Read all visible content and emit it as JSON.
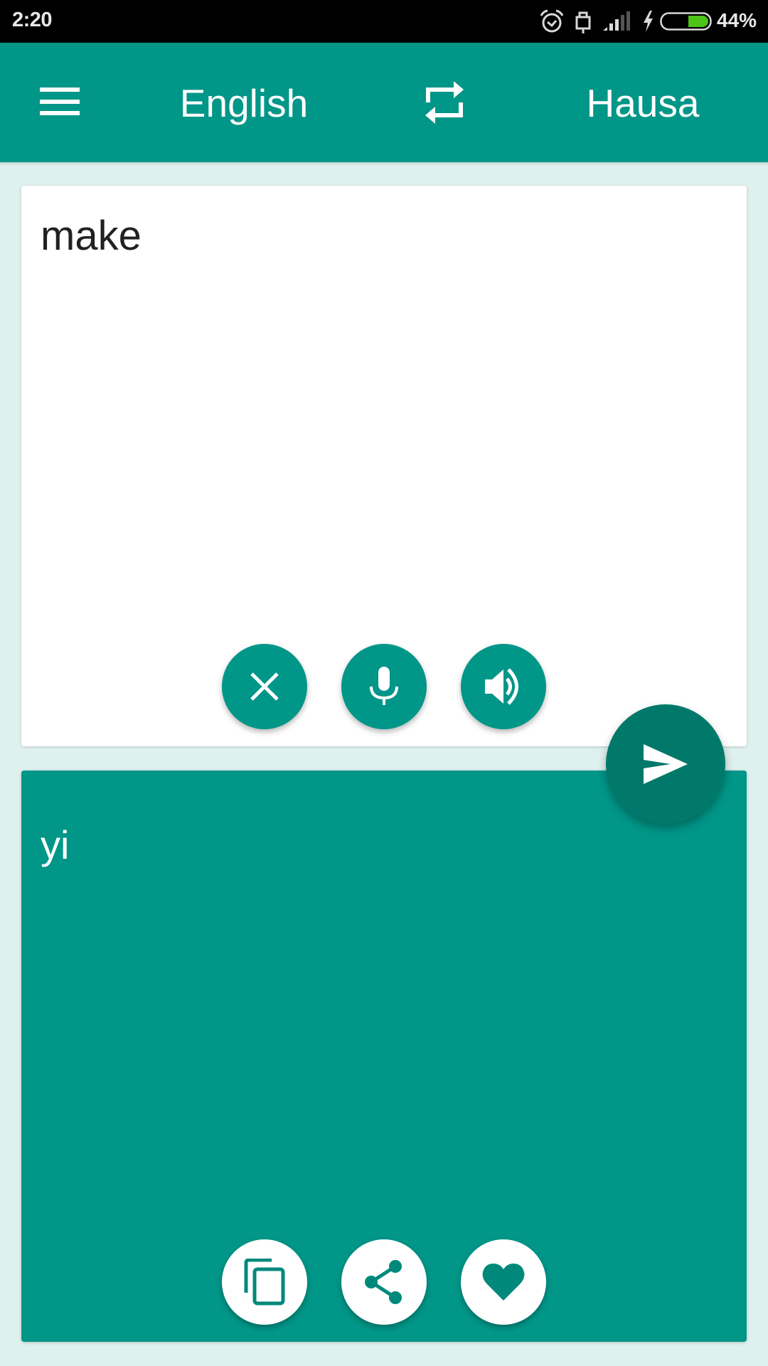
{
  "status_bar": {
    "time": "2:20",
    "battery_percent": "44%",
    "battery_level": 0.44,
    "icons": [
      "alarm-icon",
      "usb-icon",
      "signal-icon",
      "charging-icon",
      "battery-icon"
    ]
  },
  "app_bar": {
    "menu_icon": "menu-icon",
    "source_language": "English",
    "swap_icon": "swap-icon",
    "target_language": "Hausa"
  },
  "input_card": {
    "text": "make",
    "buttons": [
      {
        "name": "clear",
        "icon": "close-icon"
      },
      {
        "name": "voice-input",
        "icon": "microphone-icon"
      },
      {
        "name": "speak",
        "icon": "volume-icon"
      }
    ]
  },
  "translate_button": {
    "icon": "send-icon"
  },
  "output_card": {
    "text": "yi",
    "buttons": [
      {
        "name": "copy",
        "icon": "copy-icon"
      },
      {
        "name": "share",
        "icon": "share-icon"
      },
      {
        "name": "favorite",
        "icon": "heart-icon"
      }
    ]
  },
  "colors": {
    "primary": "#009688",
    "primary_dark": "#00796b",
    "background": "#dff1ee",
    "battery_fill": "#4cc417"
  }
}
